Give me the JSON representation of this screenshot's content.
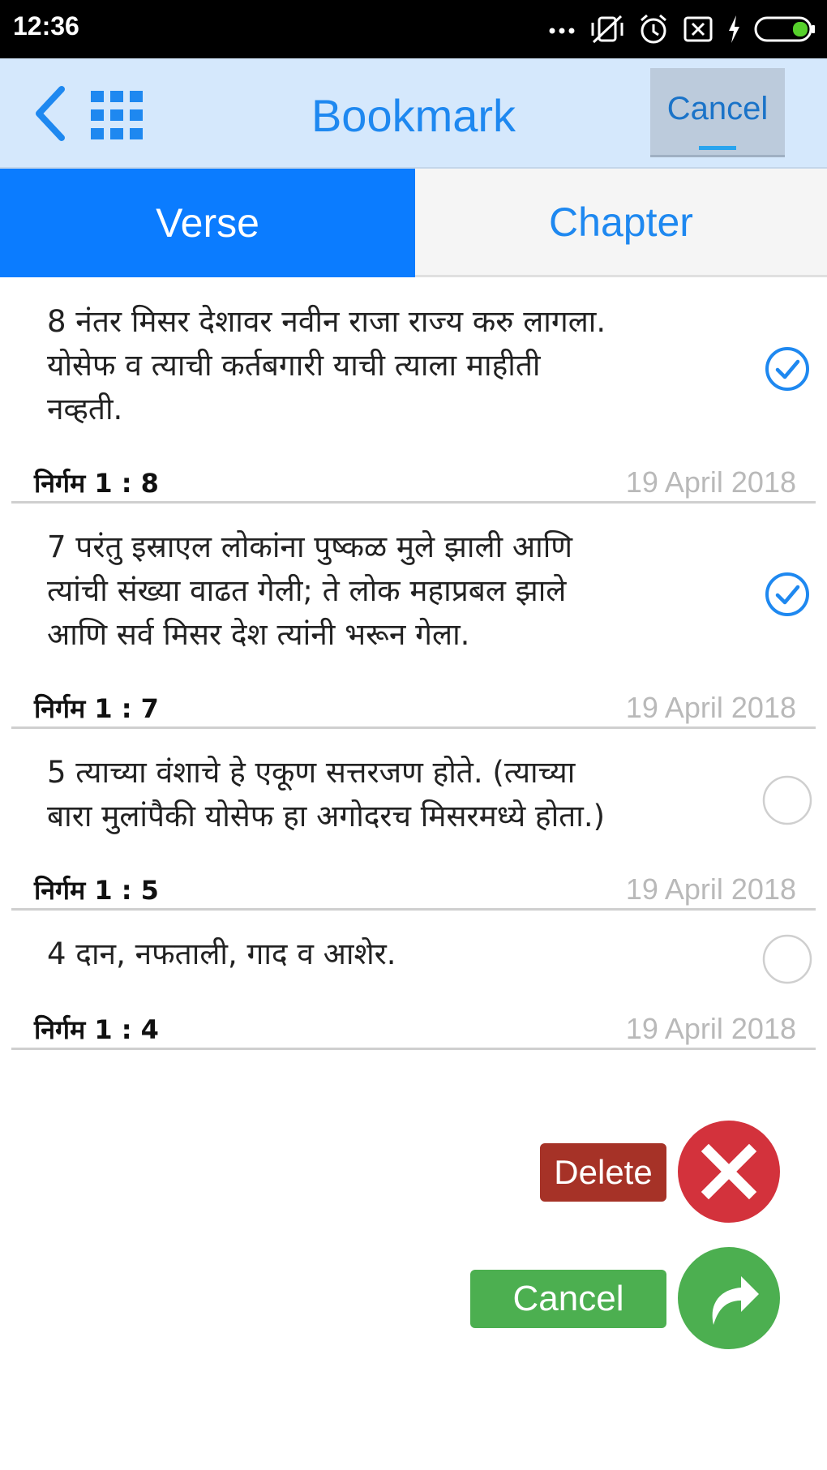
{
  "status_bar": {
    "time": "12:36",
    "icons": [
      "more-dots-icon",
      "vibrate-off-icon",
      "alarm-icon",
      "sim-x-icon",
      "charging-icon",
      "battery-icon"
    ]
  },
  "header": {
    "title": "Bookmark",
    "cancel_label": "Cancel",
    "back_icon": "back-arrow-icon",
    "grid_icon": "grid-menu-icon",
    "title_color": "#1e88f0",
    "background": "#d5e8fc"
  },
  "tabs": [
    {
      "label": "Verse",
      "active": true
    },
    {
      "label": "Chapter",
      "active": false
    }
  ],
  "bookmarks": [
    {
      "number": "8",
      "lines": [
        "8   नंतर मिसर देशावर नवीन राजा राज्य करु लागला.",
        "योसेफ व त्याची कर्तबगारी याची त्याला माहीती",
        "नव्हती."
      ],
      "reference": "निर्गम 1 : 8",
      "date": "19 April 2018",
      "checked": true
    },
    {
      "number": "7",
      "lines": [
        "7  परंतु इस्राएल लोकांना पुष्कळ मुले झाली आणि",
        "त्यांची संख्या वाढत गेली; ते लोक महाप्रबल झाले",
        "आणि सर्व मिसर देश त्यांनी भरून गेला."
      ],
      "reference": "निर्गम 1 : 7",
      "date": "19 April 2018",
      "checked": true
    },
    {
      "number": "5",
      "lines": [
        "5  त्याच्या वंशाचे हे एकूण सत्तरजण होते. (त्याच्या",
        "बारा मुलांपैकी योसेफ हा अगोदरच मिसरमध्ये होता.)"
      ],
      "reference": "निर्गम 1 : 5",
      "date": "19 April 2018",
      "checked": false
    },
    {
      "number": "4",
      "lines": [
        "4  दान, नफताली, गाद व आशेर."
      ],
      "reference": "निर्गम 1 : 4",
      "date": "19 April 2018",
      "checked": false
    }
  ],
  "actions": {
    "delete_label": "Delete",
    "cancel_label": "Cancel",
    "delete_icon": "close-x-icon",
    "cancel_icon": "share-arrow-icon",
    "delete_color": "#d3323c",
    "cancel_color": "#4caf50"
  },
  "colors": {
    "accent": "#0b7cff",
    "check": "#1e88f0"
  }
}
